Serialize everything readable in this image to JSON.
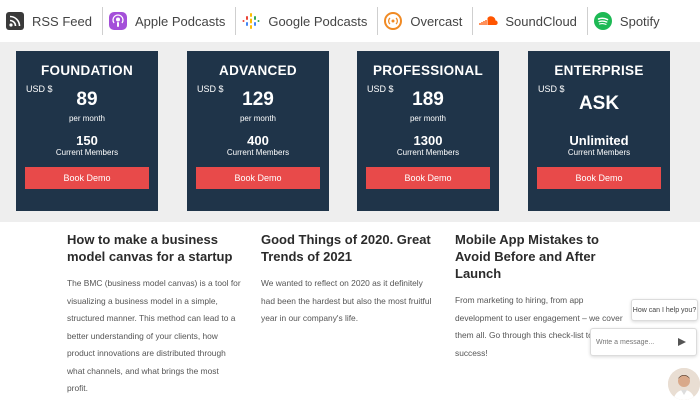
{
  "podcast_bar": {
    "items": [
      {
        "label": "RSS Feed",
        "icon": "rss-icon"
      },
      {
        "label": "Apple Podcasts",
        "icon": "apple-podcasts-icon"
      },
      {
        "label": "Google Podcasts",
        "icon": "google-podcasts-icon"
      },
      {
        "label": "Overcast",
        "icon": "overcast-icon"
      },
      {
        "label": "SoundCloud",
        "icon": "soundcloud-icon"
      },
      {
        "label": "Spotify",
        "icon": "spotify-icon"
      }
    ]
  },
  "pricing": {
    "plans": [
      {
        "name": "FOUNDATION",
        "currency": "USD $",
        "price": "89",
        "period": "per month",
        "members": "150",
        "members_label": "Current Members",
        "button": "Book Demo"
      },
      {
        "name": "ADVANCED",
        "currency": "USD $",
        "price": "129",
        "period": "per month",
        "members": "400",
        "members_label": "Current Members",
        "button": "Book Demo"
      },
      {
        "name": "PROFESSIONAL",
        "currency": "USD $",
        "price": "189",
        "period": "per month",
        "members": "1300",
        "members_label": "Current Members",
        "button": "Book Demo"
      },
      {
        "name": "ENTERPRISE",
        "currency": "USD $",
        "price": "ASK",
        "period": "",
        "members": "Unlimited",
        "members_label": "Current Members",
        "button": "Book Demo"
      }
    ]
  },
  "blog": {
    "posts": [
      {
        "title": "How to make a business model canvas for a startup",
        "excerpt": "The BMC (business model canvas) is a tool for visualizing a business model in a simple, structured manner. This method can lead to a better understanding of your clients, how product innovations are distributed through what channels, and what brings the most profit."
      },
      {
        "title": "Good Things of 2020. Great Trends of 2021",
        "excerpt": "We wanted to reflect on 2020 as it definitely had been the hardest but also the most fruitful year in our company's life."
      },
      {
        "title": "Mobile App Mistakes to Avoid Before and After Launch",
        "excerpt": "From marketing to hiring, from app development to user engagement – we cover them all. Go through this check-list to ensure success!"
      }
    ]
  },
  "chat": {
    "greeting": "How can I help you?",
    "input_placeholder": "Write a message..."
  },
  "colors": {
    "card_bg": "#1f3449",
    "button_red": "#e84a4a",
    "section_bg": "#eeeeee"
  }
}
